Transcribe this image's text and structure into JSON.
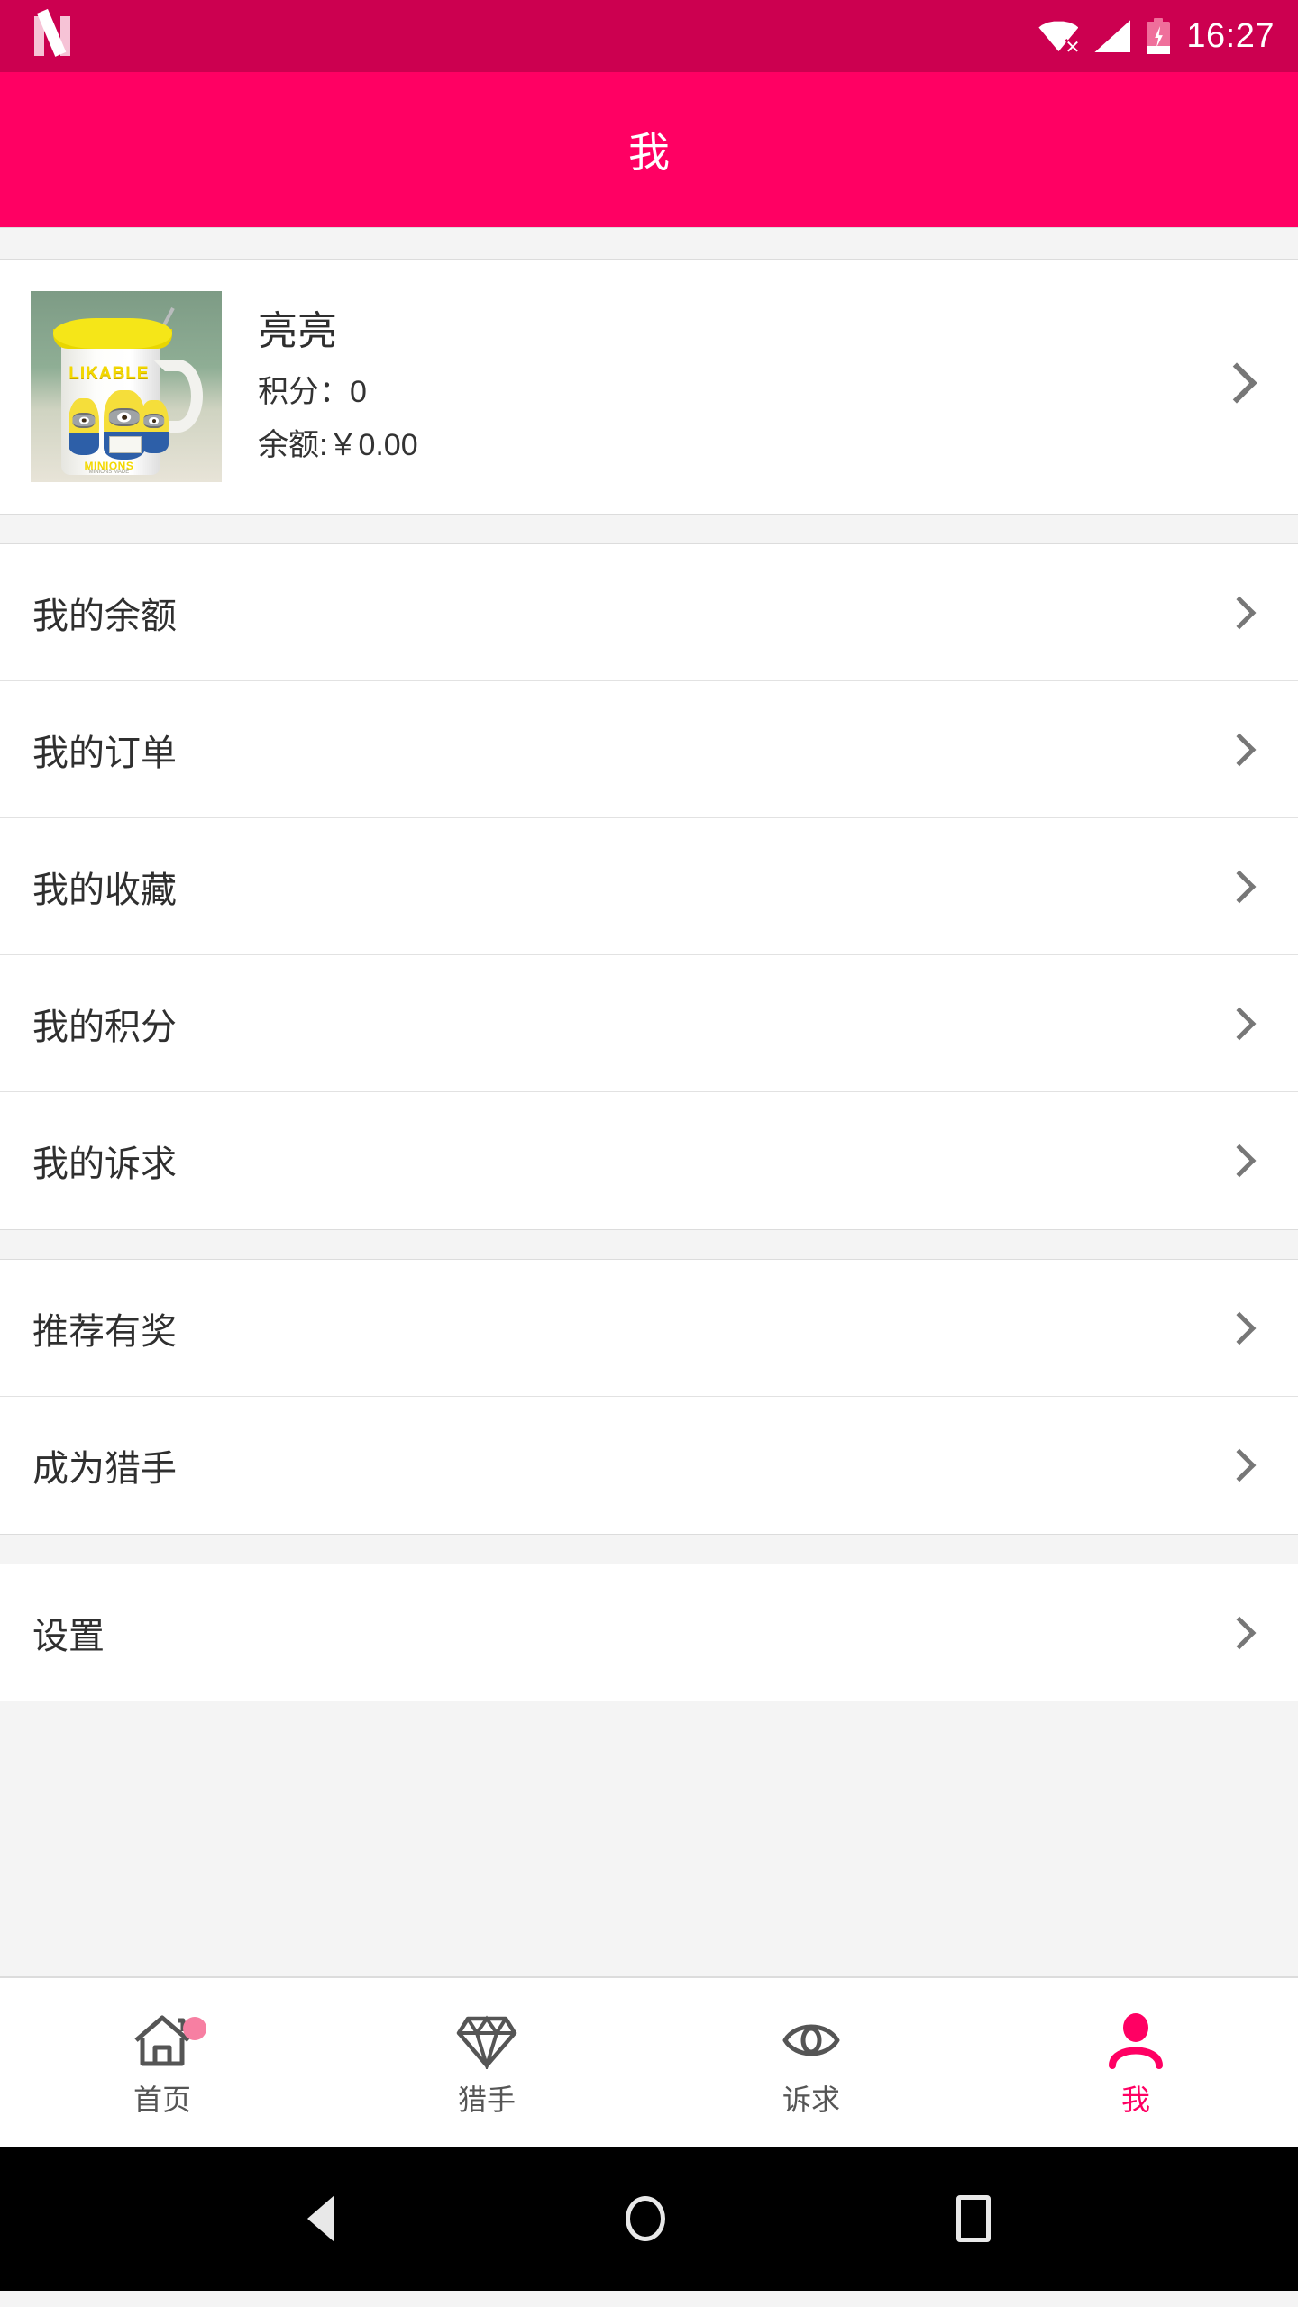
{
  "status_bar": {
    "app_logo": "n-logo-icon",
    "icons": [
      "wifi-off-icon",
      "cellular-signal-icon",
      "battery-charging-icon"
    ],
    "time": "16:27",
    "background_color": "#CC0050"
  },
  "app_bar": {
    "title": "我",
    "background_color": "#FF0063",
    "text_color": "#FFFFFF"
  },
  "profile": {
    "avatar_alt": "mug-photo-avatar",
    "avatar_text": "LIKABLE",
    "avatar_subtext": "MINIONS",
    "avatar_tiny": "MINIONS MADE",
    "name": "亮亮",
    "points_label": "积分：0",
    "balance_label": "余额:￥0.00",
    "chevron": "chevron-right-icon"
  },
  "menu_sections": [
    {
      "items": [
        {
          "label": "我的余额",
          "chevron": "chevron-right-icon"
        },
        {
          "label": "我的订单",
          "chevron": "chevron-right-icon"
        },
        {
          "label": "我的收藏",
          "chevron": "chevron-right-icon"
        },
        {
          "label": "我的积分",
          "chevron": "chevron-right-icon"
        },
        {
          "label": "我的诉求",
          "chevron": "chevron-right-icon"
        }
      ]
    },
    {
      "items": [
        {
          "label": "推荐有奖",
          "chevron": "chevron-right-icon"
        },
        {
          "label": "成为猎手",
          "chevron": "chevron-right-icon"
        }
      ]
    },
    {
      "items": [
        {
          "label": "设置",
          "chevron": "chevron-right-icon"
        }
      ]
    }
  ],
  "tab_bar": {
    "active_color": "#FF0063",
    "inactive_color": "#555555",
    "badge_color": "#F77FA2",
    "tabs": [
      {
        "label": "首页",
        "icon": "home-icon",
        "active": false,
        "badge": true
      },
      {
        "label": "猎手",
        "icon": "diamond-icon",
        "active": false,
        "badge": false
      },
      {
        "label": "诉求",
        "icon": "eye-icon",
        "active": false,
        "badge": false
      },
      {
        "label": "我",
        "icon": "person-icon",
        "active": true,
        "badge": false
      }
    ]
  },
  "android_nav": {
    "back": "back-triangle-icon",
    "home": "home-circle-icon",
    "recents": "recents-square-icon"
  }
}
